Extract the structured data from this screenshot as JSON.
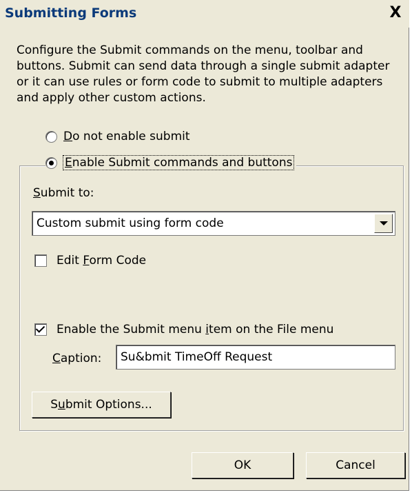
{
  "window": {
    "title": "Submitting Forms",
    "close_symbol": "X"
  },
  "description": "Configure the Submit commands on the menu, toolbar and buttons. Submit can send data through a single submit adapter or it can use rules or form code to submit to multiple adapters and apply other custom actions.",
  "options": {
    "disable": {
      "accel": "D",
      "rest": "o not enable submit",
      "selected": false
    },
    "enable": {
      "accel": "E",
      "rest": "nable Submit commands and buttons",
      "selected": true
    }
  },
  "submit_to": {
    "label_accel": "S",
    "label_rest": "ubmit to:",
    "value": "Custom submit using form code"
  },
  "edit_form_code": {
    "pre": "Edit ",
    "accel": "F",
    "rest": "orm Code",
    "checked": false
  },
  "enable_menu_item": {
    "pre": "Enable the Submit menu ",
    "accel": "i",
    "rest": "tem on the File menu",
    "checked": true
  },
  "caption": {
    "label_accel": "C",
    "label_rest": "aption:",
    "value": "Su&bmit TimeOff Request"
  },
  "submit_options_button": {
    "pre": "S",
    "accel": "u",
    "rest": "bmit Options..."
  },
  "buttons": {
    "ok": "OK",
    "cancel": "Cancel"
  }
}
